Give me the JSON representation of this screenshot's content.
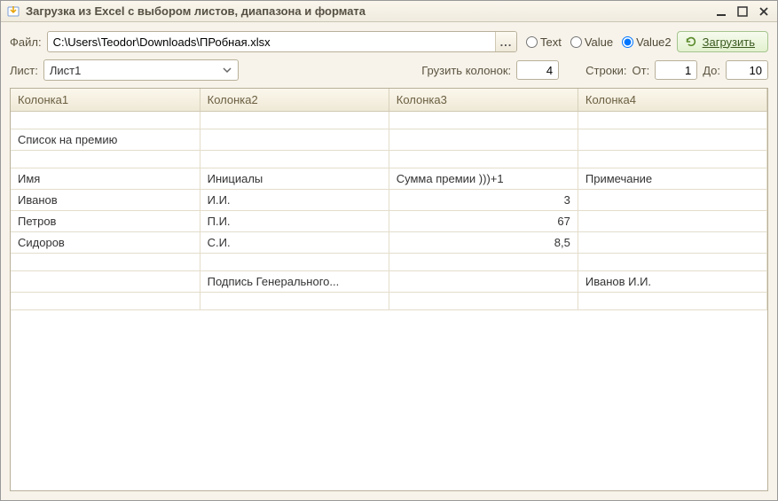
{
  "window": {
    "title": "Загрузка из Excel с выбором листов, диапазона и формата"
  },
  "toolbar": {
    "file_label": "Файл:",
    "file_path": "C:\\Users\\Teodor\\Downloads\\ПРобная.xlsx",
    "browse_label": "...",
    "radios": {
      "text": "Text",
      "value": "Value",
      "value2": "Value2",
      "selected": "value2"
    },
    "load_label": "Загрузить"
  },
  "params": {
    "sheet_label": "Лист:",
    "sheet_selected": "Лист1",
    "cols_label": "Грузить колонок:",
    "cols_value": "4",
    "rows_label": "Строки:",
    "from_label": "От:",
    "from_value": "1",
    "to_label": "До:",
    "to_value": "10"
  },
  "table": {
    "headers": [
      "Колонка1",
      "Колонка2",
      "Колонка3",
      "Колонка4"
    ],
    "rows": [
      {
        "c1": "",
        "c2": "",
        "c3": "",
        "c4": "",
        "c3num": false
      },
      {
        "c1": "Список на премию",
        "c2": "",
        "c3": "",
        "c4": "",
        "c3num": false
      },
      {
        "c1": "",
        "c2": "",
        "c3": "",
        "c4": "",
        "c3num": false
      },
      {
        "c1": "Имя",
        "c2": "Инициалы",
        "c3": "Сумма премии )))+1",
        "c4": "Примечание",
        "c3num": false
      },
      {
        "c1": "Иванов",
        "c2": "И.И.",
        "c3": "3",
        "c4": "",
        "c3num": true
      },
      {
        "c1": "Петров",
        "c2": "П.И.",
        "c3": "67",
        "c4": "",
        "c3num": true
      },
      {
        "c1": "Сидоров",
        "c2": "С.И.",
        "c3": "8,5",
        "c4": "",
        "c3num": true
      },
      {
        "c1": "",
        "c2": "",
        "c3": "",
        "c4": "",
        "c3num": false
      },
      {
        "c1": "",
        "c2": "Подпись Генерального...",
        "c3": "",
        "c4": "Иванов И.И.",
        "c3num": false
      },
      {
        "c1": "",
        "c2": "",
        "c3": "",
        "c4": "",
        "c3num": false
      }
    ]
  }
}
